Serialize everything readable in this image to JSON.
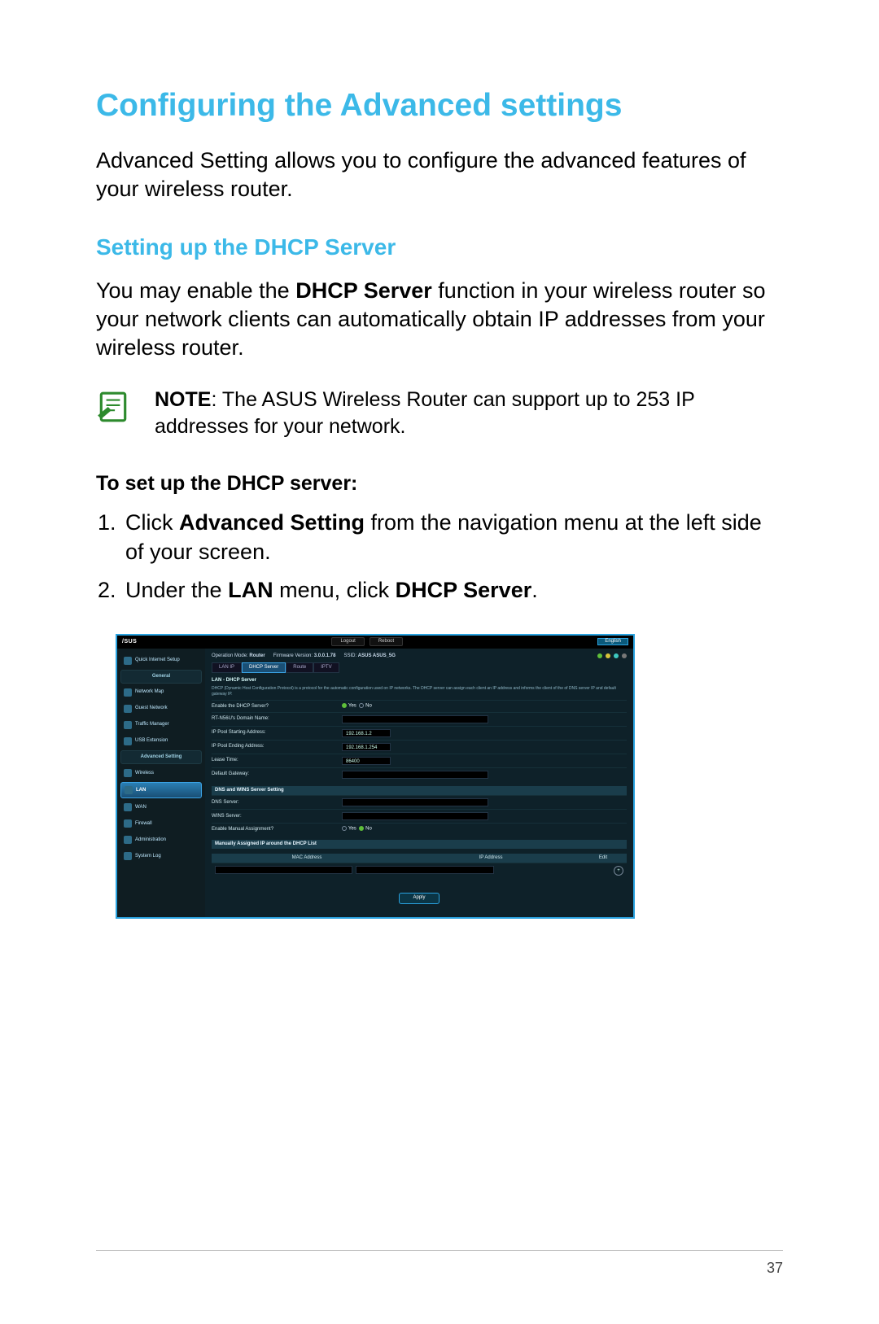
{
  "page": {
    "heading": "Configuring the Advanced settings",
    "intro": "Advanced Setting allows you to configure the advanced features of your wireless router.",
    "sub_heading": "Setting up the DHCP Server",
    "body_pre": "You may enable the ",
    "body_bold": "DHCP Server",
    "body_post": " function in your wireless router so your network clients can automatically obtain IP addresses from your wireless router.",
    "note_label": "NOTE",
    "note_text": ":    The ASUS Wireless Router can support up to 253 IP addresses for your network.",
    "steps_heading": "To set up the DHCP server:",
    "step1_pre": "Click ",
    "step1_bold": "Advanced Setting",
    "step1_post": " from the navigation menu at the left side of your screen.",
    "step2_pre": "Under the ",
    "step2_bold1": "LAN",
    "step2_mid": " menu, click ",
    "step2_bold2": "DHCP Server",
    "step2_post": ".",
    "page_number": "37"
  },
  "router": {
    "logo": "/SUS",
    "top_buttons": {
      "logout": "Logout",
      "reboot": "Reboot"
    },
    "language": "English",
    "header": {
      "op_mode_label": "Operation Mode:",
      "op_mode": "Router",
      "fw_label": "Firmware Version:",
      "fw": "3.0.0.1.78",
      "ssid_label": "SSID:",
      "ssid": "ASUS  ASUS_5G"
    },
    "tabs": [
      "LAN IP",
      "DHCP Server",
      "Route",
      "IPTV"
    ],
    "sidebar": {
      "qis": "Quick Internet Setup",
      "general": "General",
      "items_general": [
        "Network Map",
        "Guest Network",
        "Traffic Manager",
        "USB Extension"
      ],
      "advanced": "Advanced Setting",
      "items_advanced": [
        "Wireless",
        "LAN",
        "WAN",
        "Firewall",
        "Administration",
        "System Log"
      ]
    },
    "panel": {
      "title": "LAN - DHCP Server",
      "desc": "DHCP (Dynamic Host Configuration Protocol) is a protocol for the automatic configuration used on IP networks. The DHCP server can assign each client an IP address and informs the client of the of DNS server IP and default gateway IP.",
      "rows": {
        "enable_label": "Enable the DHCP Server?",
        "yes": "Yes",
        "no": "No",
        "domain_label": "RT-N56U's Domain Name:",
        "start_label": "IP Pool Starting Address:",
        "start_val": "192.168.1.2",
        "end_label": "IP Pool Ending Address:",
        "end_val": "192.168.1.254",
        "lease_label": "Lease Time:",
        "lease_val": "86400",
        "gw_label": "Default Gateway:"
      },
      "dns_head": "DNS and WINS Server Setting",
      "dns_label": "DNS Server:",
      "wins_label": "WINS Server:",
      "manual_label": "Enable Manual Assignment?",
      "tbl_head": "Manually Assigned IP around the DHCP List",
      "col_mac": "MAC Address",
      "col_ip": "IP Address",
      "col_edit": "Edit",
      "apply": "Apply"
    }
  }
}
